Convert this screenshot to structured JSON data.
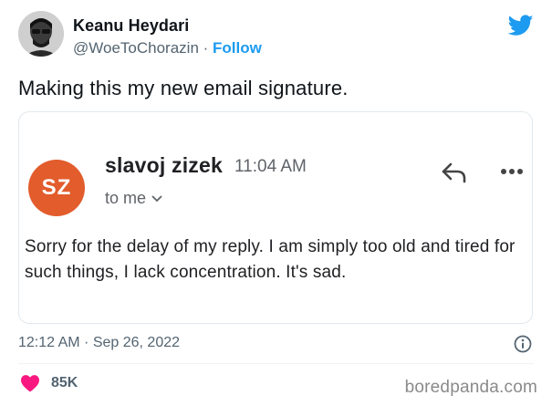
{
  "author": {
    "name": "Keanu Heydari",
    "handle": "@WoeToChorazin",
    "separator": " · ",
    "follow_label": "Follow",
    "avatar_icon": "profile-avatar"
  },
  "tweet": {
    "text": "Making this my new email signature.",
    "timestamp": "12:12 AM · Sep 26, 2022",
    "likes": "85K"
  },
  "email": {
    "sender_initials": "SZ",
    "sender_name": "slavoj zizek",
    "time": "11:04 AM",
    "recipient": "to me",
    "body": "Sorry for the delay of my reply. I am simply too old and tired for such things, I lack concentration. It's sad."
  },
  "watermark": "boredpanda.com",
  "colors": {
    "twitter_blue": "#1d9bf0",
    "sender_avatar": "#e25c2c",
    "heart": "#f91880"
  }
}
